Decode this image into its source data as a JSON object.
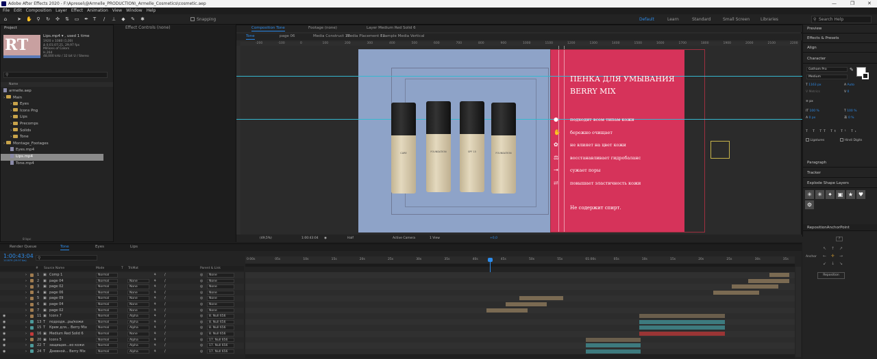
{
  "app": {
    "title": "Adobe After Effects 2020 - F:\\Apresei\\@Armelle_PRODUCTION\\_Armelle_Cosmetics\\cosmetic.aep",
    "min": "—",
    "max": "❐",
    "close": "✕"
  },
  "menu": [
    "File",
    "Edit",
    "Composition",
    "Layer",
    "Effect",
    "Animation",
    "View",
    "Window",
    "Help"
  ],
  "toolbar": {
    "snapping": "Snapping",
    "workspaces": [
      "Default",
      "Learn",
      "Standard",
      "Small Screen",
      "Libraries"
    ],
    "search_placeholder": "Search Help"
  },
  "project": {
    "title": "Project",
    "effect_controls": "Effect Controls (none)",
    "thumb": "RT",
    "clip": "Lips.mp4 ▾ , used 1 time",
    "info": [
      "1920 x 1080 (1,00)",
      "Δ 0;01;07;21, 29,97 fps",
      "Millions of Colors",
      "H.264",
      "48,000 kHz / 32 bit U / Stereo"
    ],
    "col_name": "Name",
    "items": [
      {
        "label": "armelle.aep",
        "type": "file",
        "indent": 0
      },
      {
        "label": "Main",
        "type": "folder",
        "indent": 0
      },
      {
        "label": "Eyes",
        "type": "folder",
        "indent": 1
      },
      {
        "label": "Icons Png",
        "type": "folder",
        "indent": 1
      },
      {
        "label": "Lips",
        "type": "folder",
        "indent": 1
      },
      {
        "label": "Precomps",
        "type": "folder",
        "indent": 1
      },
      {
        "label": "Solids",
        "type": "folder",
        "indent": 1
      },
      {
        "label": "Tone",
        "type": "folder",
        "indent": 1
      },
      {
        "label": "Montage_Footages",
        "type": "folder",
        "indent": 0
      },
      {
        "label": "Eyes.mp4",
        "type": "file",
        "indent": 1
      },
      {
        "label": "Lips.mp4",
        "type": "file",
        "indent": 1,
        "selected": true
      },
      {
        "label": "Tone.mp4",
        "type": "file",
        "indent": 1
      }
    ],
    "bpc": "8 bpc"
  },
  "comp": {
    "tabs": [
      "Composition Tone",
      "Footage (none)",
      "Layer Medium Red Solid 6"
    ],
    "nav": [
      "Tone",
      "page 06",
      "Media Construct 13",
      "Media Placement 13",
      "Example Media Vertical"
    ],
    "ruler_labels": [
      "-200",
      "-100",
      "0",
      "100",
      "200",
      "300",
      "400",
      "500",
      "600",
      "700",
      "800",
      "900",
      "1000",
      "1100",
      "1200",
      "1300",
      "1400",
      "1500",
      "1600",
      "1700",
      "1800",
      "1900",
      "2000",
      "2100",
      "2200"
    ],
    "bottle_label": [
      "CARE",
      "FOUNDATION",
      "SPF 15"
    ],
    "title1": "ПЕНКА ДЛЯ УМЫВАНИЯ",
    "title2": "BERRY MIX",
    "features": [
      "подходит всем типам кожи",
      "бережно очищает",
      "не влияет на цвет кожи",
      "восстанавливает гидробаланс",
      "сужает поры",
      "повышает эластичность кожи"
    ],
    "note": "Не содержит спирт.",
    "footer": {
      "zoom": "(49,5%)",
      "time": "1:00:43:04",
      "res": "Half",
      "camera": "Active Camera",
      "view": "1 View",
      "exposure": "+0,0"
    }
  },
  "right": {
    "panels": [
      "Preview",
      "Effects & Presets",
      "Align",
      "Character",
      "Paragraph",
      "Tracker",
      "Explode Shape Layers",
      "RepositionAnchorPoint"
    ],
    "font": "Gotham Pro",
    "style": "Medium",
    "size": "1163 px",
    "leading": "Auto",
    "kerning": "Metrics",
    "tracking": "0",
    "unit": "px",
    "vscale": "100 %",
    "hscale": "100 %",
    "baseline": "0 px",
    "tsume": "0 %",
    "ligatures": "Ligatures",
    "hindi": "Hindi Digits",
    "anchor_label": "Anchor",
    "reposition": "Reposition",
    "question": "?"
  },
  "timeline": {
    "tabs": [
      "Render Queue",
      "Tone",
      "Eyes",
      "Lips"
    ],
    "time": "1:00:43:04",
    "frames": "111879 (29.97 fps)",
    "headers": {
      "num": "#",
      "source": "Source Name",
      "mode": "Mode",
      "t": "T",
      "trkmat": "TrkMat",
      "parent": "Parent & Link"
    },
    "ticks": [
      "0:00s",
      "05s",
      "10s",
      "15s",
      "20s",
      "25s",
      "30s",
      "35s",
      "40s",
      "45s",
      "50s",
      "55s",
      "01:00s",
      "05s",
      "10s",
      "15s",
      "20s",
      "25s",
      "30s",
      "35s"
    ],
    "layers": [
      {
        "num": "1",
        "name": "Comp 1",
        "mode": "Normal",
        "t": "",
        "trk": "",
        "parent": "None",
        "color": "#a07c50"
      },
      {
        "num": "2",
        "name": "page 04",
        "mode": "Normal",
        "t": "",
        "trk": "None",
        "parent": "None",
        "color": "#a07c50"
      },
      {
        "num": "3",
        "name": "page 02",
        "mode": "Normal",
        "t": "",
        "trk": "None",
        "parent": "None",
        "color": "#a07c50"
      },
      {
        "num": "4",
        "name": "page 06",
        "mode": "Normal",
        "t": "",
        "trk": "None",
        "parent": "None",
        "color": "#a07c50"
      },
      {
        "num": "5",
        "name": "page 09",
        "mode": "Normal",
        "t": "",
        "trk": "None",
        "parent": "None",
        "color": "#a07c50"
      },
      {
        "num": "6",
        "name": "page 04",
        "mode": "Normal",
        "t": "",
        "trk": "None",
        "parent": "None",
        "color": "#a07c50"
      },
      {
        "num": "7",
        "name": "page 02",
        "mode": "Normal",
        "t": "",
        "trk": "None",
        "parent": "None",
        "color": "#a07c50"
      },
      {
        "num": "11",
        "name": "Icons 7",
        "mode": "Normal",
        "t": "",
        "trk": "Alpha",
        "parent": "8. Null 656",
        "color": "#a07c50"
      },
      {
        "num": "13",
        "name": "подходя...ры/кожи",
        "mode": "Normal",
        "t": "T",
        "trk": "Alpha",
        "parent": "8. Null 656",
        "color": "#4d9a9a"
      },
      {
        "num": "15",
        "name": "Крем для... Berry Mix",
        "mode": "Normal",
        "t": "T",
        "trk": "Alpha",
        "parent": "8. Null 656",
        "color": "#4d9a9a"
      },
      {
        "num": "16",
        "name": "Medium Red Solid 6",
        "mode": "Normal",
        "t": "",
        "trk": "None",
        "parent": "8. Null 656",
        "color": "#c43a3a"
      },
      {
        "num": "20",
        "name": "Icons 5",
        "mode": "Normal",
        "t": "",
        "trk": "Alpha",
        "parent": "17. Null 656",
        "color": "#a07c50"
      },
      {
        "num": "22",
        "name": "защищае...ео кожи",
        "mode": "Normal",
        "t": "T",
        "trk": "Alpha",
        "parent": "17. Null 656",
        "color": "#4d9a9a"
      },
      {
        "num": "24",
        "name": "Дневной... Berry Mix",
        "mode": "Normal",
        "t": "T",
        "trk": "Alpha",
        "parent": "17. Null 656",
        "color": "#4d9a9a"
      }
    ],
    "bars": [
      {
        "start": 1123,
        "end": 1152,
        "color": "#7a6a52"
      },
      {
        "start": 1092,
        "end": 1152,
        "color": "#7a6a52"
      },
      {
        "start": 1068,
        "end": 1136,
        "color": "#7a6a52"
      },
      {
        "start": 1041,
        "end": 1108,
        "color": "#7a6a52"
      },
      {
        "start": 758,
        "end": 822,
        "color": "#7a6a52"
      },
      {
        "start": 738,
        "end": 798,
        "color": "#7a6a52"
      },
      {
        "start": 710,
        "end": 770,
        "color": "#7a6a52"
      },
      {
        "start": 933,
        "end": 1058,
        "color": "#6a5e4c"
      },
      {
        "start": 933,
        "end": 1058,
        "color": "#3d7a7e"
      },
      {
        "start": 933,
        "end": 1058,
        "color": "#3d7a7e"
      },
      {
        "start": 933,
        "end": 1058,
        "color": "#9a3535"
      },
      {
        "start": 855,
        "end": 935,
        "color": "#6a5e4c"
      },
      {
        "start": 855,
        "end": 935,
        "color": "#3d7a7e"
      },
      {
        "start": 855,
        "end": 935,
        "color": "#3d7a7e"
      }
    ],
    "playhead": 715
  }
}
